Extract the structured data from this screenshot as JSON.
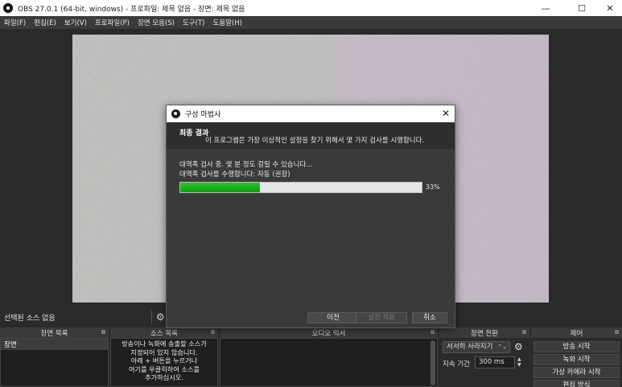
{
  "window": {
    "title": "OBS 27.0.1 (64-bit, windows) - 프로파일: 제목 없음 - 장면: 제목 없음",
    "minimize": "—",
    "maximize": "☐",
    "close": "✕"
  },
  "menu": [
    "파일(F)",
    "편집(E)",
    "보기(V)",
    "프로파일(P)",
    "장면 모음(S)",
    "도구(T)",
    "도움말(H)"
  ],
  "source_bar": {
    "no_source": "선택된 소스 없음"
  },
  "docks": {
    "scenes": {
      "title": "장면 목록",
      "items": [
        "장면"
      ]
    },
    "sources": {
      "title": "소스 목록",
      "empty_lines": [
        "방송이나 녹화에 송출할 소스가",
        "지정되어 있지 않습니다.",
        "아래 + 버튼을 누르거나",
        "여기를 우클릭하여 소스를",
        "추가하십시오."
      ]
    },
    "audio": {
      "title": "오디오 믹서"
    },
    "transitions": {
      "title": "장면 전환",
      "selected": "서서히 사라지기",
      "duration_label": "지속 기간",
      "duration_value": "300 ms"
    },
    "controls": {
      "title": "제어",
      "buttons": [
        "방송 시작",
        "녹화 시작",
        "가상 카메라 시작",
        "편집 방식"
      ]
    }
  },
  "dialog": {
    "title": "구성 마법사",
    "close": "✕",
    "heading": "최종 결과",
    "description": "이 프로그램은 가장 이상적인 설정을 찾기 위해서 몇 가지 검사를 시행합니다.",
    "status_line1": "대역폭 검사 중. 몇 분 정도 걸릴 수 있습니다...",
    "status_line2": "대역폭 검사를 수행합니다: 자동 (권장)",
    "progress": 33,
    "progress_text": "33%",
    "buttons": {
      "back": "이전",
      "apply": "설정 적용",
      "cancel": "취소"
    }
  },
  "colors": {
    "progress": "#16a616",
    "dark_bg": "#2b2b2b",
    "dock_header": "#3a3a3a"
  }
}
